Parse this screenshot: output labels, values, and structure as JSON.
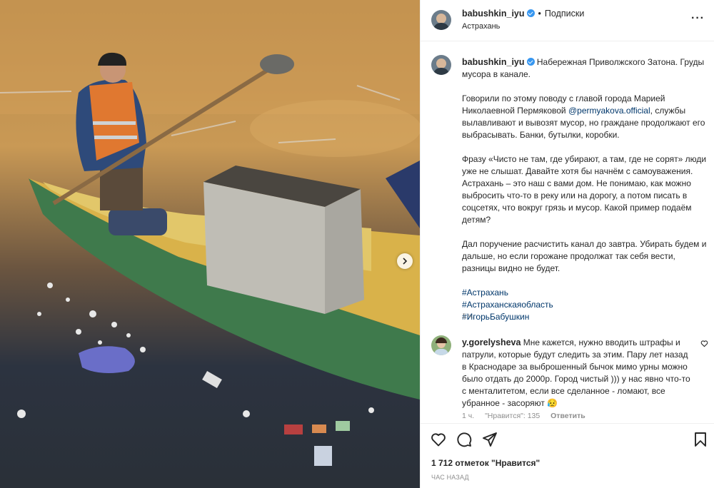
{
  "post": {
    "username": "babushkin_iyu",
    "follow_label": "Подписки",
    "location": "Астрахань",
    "caption_lead": "Набережная Приволжского Затона. Груды мусора в канале.",
    "caption_p2a": "Говорили по этому поводу с главой города Марией Николаевной Пермяковой ",
    "caption_mention": "@permyakova.official",
    "caption_p2b": ", службы вылавливают и вывозят мусор, но граждане продолжают его выбрасывать. Банки, бутылки, коробки.",
    "caption_p3": "Фразу «Чисто не там, где убирают, а там, где не сорят» люди уже не слышат. Давайте хотя бы начнём с самоуважения. Астрахань – это наш с вами дом. Не понимаю, как можно выбросить что-то в реку или на дорогу, а потом писать в соцсетях, что вокруг грязь и мусор. Какой пример подаём детям?",
    "caption_p4": "Дал поручение расчистить канал до завтра. Убирать будем и дальше, но если горожане продолжат так себя вести, разницы видно не будет.",
    "hashtags": [
      "#Астрахань",
      "#Астраханскаяобласть",
      "#ИгорьБабушкин"
    ],
    "caption_time": "1 ч.",
    "likes": "1 712 отметок \"Нравится\"",
    "posted_ago": "ЧАС НАЗАД"
  },
  "comment": {
    "username": "y.gorelysheva",
    "text": "Мне кажется, нужно вводить штрафы и патрули, которые будут следить за этим. Пару лет назад в Краснодаре за выброшенный бычок мимо урны можно было отдать до 2000р. Город чистый ))) у нас явно что-то с менталитетом, если все сделанное - ломают, все убранное - засоряют 😥",
    "time": "1 ч.",
    "likes": "\"Нравится\": 135",
    "reply": "Ответить"
  },
  "icons": {
    "more": "more-options-icon",
    "like": "heart-icon",
    "comment": "comment-icon",
    "share": "share-icon",
    "save": "bookmark-icon",
    "next": "chevron-right-icon"
  },
  "colors": {
    "link": "#00376b",
    "verified": "#3897f0",
    "muted": "#8e8e8e"
  }
}
